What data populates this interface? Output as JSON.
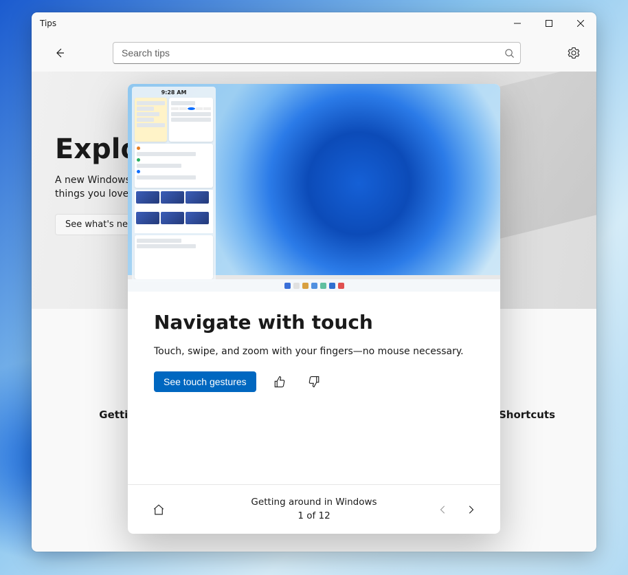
{
  "window": {
    "title": "Tips"
  },
  "header": {
    "search_placeholder": "Search tips"
  },
  "hero": {
    "title": "Explore",
    "subtitle_line1": "A new Windows",
    "subtitle_line2": "things you love",
    "cta": "See what's new"
  },
  "bg_cards": {
    "left": "Getting",
    "right": "Shortcuts"
  },
  "tip": {
    "image_time": "9:28 AM",
    "title": "Navigate with touch",
    "description": "Touch, swipe, and zoom with your fingers—no mouse necessary.",
    "cta": "See touch gestures"
  },
  "footer": {
    "collection": "Getting around in Windows",
    "position": "1 of 12"
  }
}
